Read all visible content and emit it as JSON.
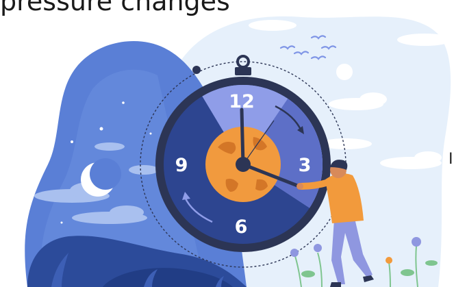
{
  "top_caption": "pressure changes",
  "side_fragment": "I",
  "clock": {
    "numerals": [
      "12",
      "3",
      "6",
      "9"
    ]
  },
  "colors": {
    "night_sky": "#5a7fd6",
    "day_sky": "#eaf2fb",
    "clock_rim": "#2c3555",
    "clock_dark_half": "#2d4590",
    "clock_light_half": "#8f9de8",
    "globe": "#f19a3e",
    "person_shirt": "#f29a3c",
    "person_pants": "#8f97e0"
  }
}
